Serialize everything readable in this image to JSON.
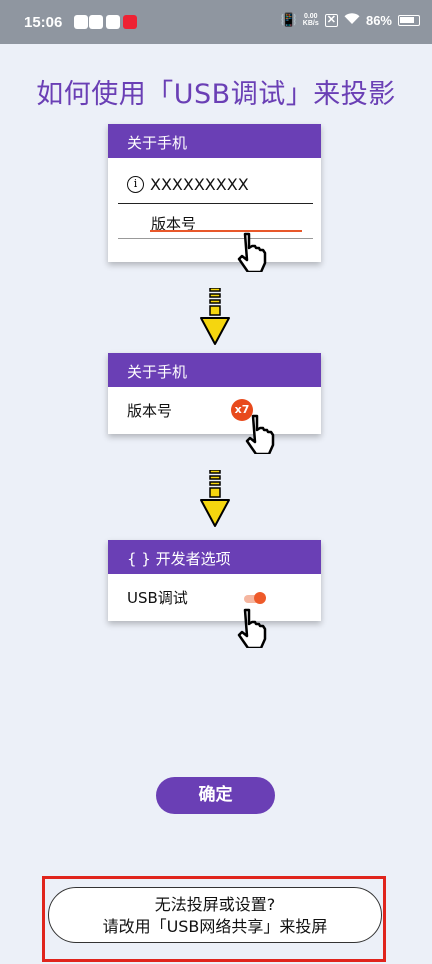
{
  "status_bar": {
    "time": "15:06",
    "net_speed_value": "0.00",
    "net_speed_unit": "KB/s",
    "battery": "86%"
  },
  "title": "如何使用「USB调试」来投影",
  "step1": {
    "header": "关于手机",
    "row1": "XXXXXXXXX",
    "row2": "版本号"
  },
  "step2": {
    "header": "关于手机",
    "row": "版本号",
    "tap_count": "x7"
  },
  "step3": {
    "header": "{ } 开发者选项",
    "row": "USB调试"
  },
  "confirm_label": "确定",
  "fallback": {
    "line1": "无法投屏或设置?",
    "line2": "请改用「USB网络共享」来投屏"
  },
  "colors": {
    "accent": "#6a3fb5",
    "badge": "#e84a1c",
    "arrow": "#f5d60f",
    "highlight_box": "#e0241c"
  }
}
